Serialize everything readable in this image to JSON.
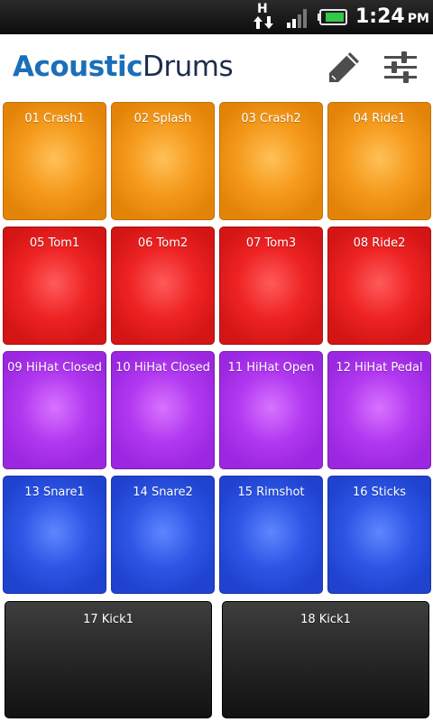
{
  "status_bar": {
    "network_letter": "H",
    "time": "1:24",
    "ampm": "PM",
    "icons": [
      "network-transfer-icon",
      "signal-icon",
      "battery-icon"
    ]
  },
  "header": {
    "title_part1": "Acoustic",
    "title_part2": "Drums",
    "title_colors": {
      "part1": "#1b6fb7",
      "part2": "#1e2c4d"
    },
    "icons": [
      "pencil-icon",
      "sliders-icon"
    ]
  },
  "pad_colors": {
    "orange": "#f59a1c",
    "red": "#ee2323",
    "purple": "#b138f0",
    "blue": "#2d56e6",
    "black": "#262626"
  },
  "pads": [
    {
      "label": "01 Crash1",
      "color": "orange"
    },
    {
      "label": "02 Splash",
      "color": "orange"
    },
    {
      "label": "03 Crash2",
      "color": "orange"
    },
    {
      "label": "04 Ride1",
      "color": "orange"
    },
    {
      "label": "05 Tom1",
      "color": "red"
    },
    {
      "label": "06 Tom2",
      "color": "red"
    },
    {
      "label": "07 Tom3",
      "color": "red"
    },
    {
      "label": "08 Ride2",
      "color": "red"
    },
    {
      "label": "09 HiHat Closed",
      "color": "purple"
    },
    {
      "label": "10 HiHat Closed",
      "color": "purple"
    },
    {
      "label": "11 HiHat Open",
      "color": "purple"
    },
    {
      "label": "12 HiHat Pedal",
      "color": "purple"
    },
    {
      "label": "13 Snare1",
      "color": "blue"
    },
    {
      "label": "14 Snare2",
      "color": "blue"
    },
    {
      "label": "15 Rimshot",
      "color": "blue"
    },
    {
      "label": "16 Sticks",
      "color": "blue"
    },
    {
      "label": "17 Kick1",
      "color": "black"
    },
    {
      "label": "18 Kick1",
      "color": "black"
    }
  ]
}
